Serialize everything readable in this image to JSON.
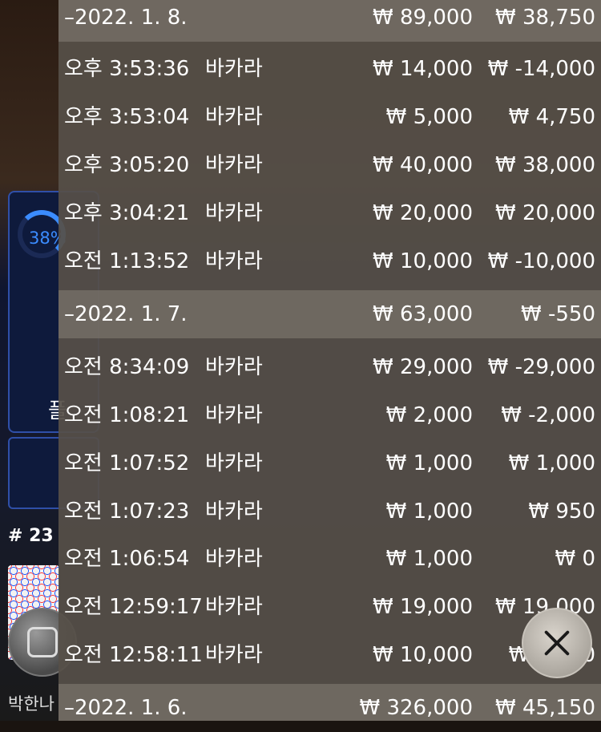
{
  "background": {
    "percent": "38%",
    "partial_label": "플",
    "room_number": "# 23",
    "user_name": "박한나"
  },
  "history": [
    {
      "type": "date",
      "date": "–2022. 1. 8.",
      "bet": "₩ 89,000",
      "win": "₩ 38,750"
    },
    {
      "type": "item",
      "time": "오후 3:53:36",
      "game": "바카라",
      "bet": "₩ 14,000",
      "win": "₩ -14,000"
    },
    {
      "type": "item",
      "time": "오후 3:53:04",
      "game": "바카라",
      "bet": "₩ 5,000",
      "win": "₩ 4,750"
    },
    {
      "type": "item",
      "time": "오후 3:05:20",
      "game": "바카라",
      "bet": "₩ 40,000",
      "win": "₩ 38,000"
    },
    {
      "type": "item",
      "time": "오후 3:04:21",
      "game": "바카라",
      "bet": "₩ 20,000",
      "win": "₩ 20,000"
    },
    {
      "type": "item",
      "time": "오전 1:13:52",
      "game": "바카라",
      "bet": "₩ 10,000",
      "win": "₩ -10,000"
    },
    {
      "type": "date",
      "date": "–2022. 1. 7.",
      "bet": "₩ 63,000",
      "win": "₩ -550"
    },
    {
      "type": "item",
      "time": "오전 8:34:09",
      "game": "바카라",
      "bet": "₩ 29,000",
      "win": "₩ -29,000"
    },
    {
      "type": "item",
      "time": "오전 1:08:21",
      "game": "바카라",
      "bet": "₩ 2,000",
      "win": "₩ -2,000"
    },
    {
      "type": "item",
      "time": "오전 1:07:52",
      "game": "바카라",
      "bet": "₩ 1,000",
      "win": "₩ 1,000"
    },
    {
      "type": "item",
      "time": "오전 1:07:23",
      "game": "바카라",
      "bet": "₩ 1,000",
      "win": "₩ 950"
    },
    {
      "type": "item",
      "time": "오전 1:06:54",
      "game": "바카라",
      "bet": "₩ 1,000",
      "win": "₩ 0"
    },
    {
      "type": "item",
      "time": "오전 12:59:17",
      "game": "바카라",
      "bet": "₩ 19,000",
      "win": "₩ 19,000"
    },
    {
      "type": "item",
      "time": "오전 12:58:11",
      "game": "바카라",
      "bet": "₩ 10,000",
      "win": "₩ 9,500"
    },
    {
      "type": "date",
      "date": "–2022. 1. 6.",
      "bet": "₩ 326,000",
      "win": "₩ 45,150"
    }
  ],
  "close_icon": "close-icon"
}
